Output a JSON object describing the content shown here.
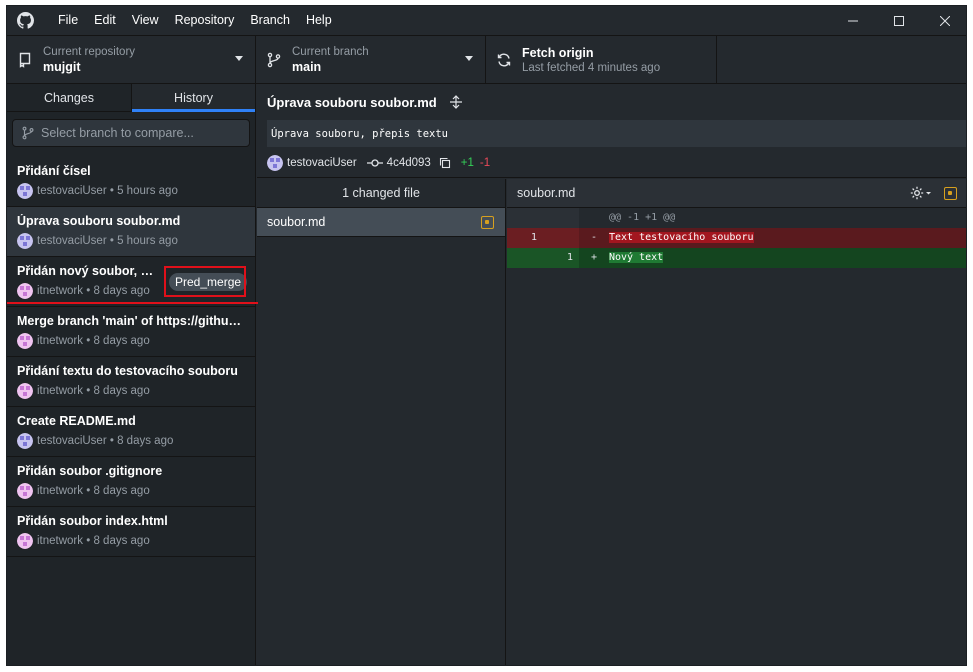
{
  "menu": [
    "File",
    "Edit",
    "View",
    "Repository",
    "Branch",
    "Help"
  ],
  "toolbar": {
    "repo": {
      "label": "Current repository",
      "value": "mujgit"
    },
    "branch": {
      "label": "Current branch",
      "value": "main"
    },
    "fetch": {
      "label": "Fetch origin",
      "value": "Last fetched 4 minutes ago"
    }
  },
  "sidebar": {
    "tabs": {
      "changes": "Changes",
      "history": "History"
    },
    "active_tab": "History",
    "compare_placeholder": "Select branch to compare...",
    "commits": [
      {
        "title": "Přidání čísel",
        "author": "testovaciUser",
        "time": "5 hours ago"
      },
      {
        "title": "Úprava souboru soubor.md",
        "author": "testovaciUser",
        "time": "5 hours ago",
        "selected": true
      },
      {
        "title": "Přidán nový soubor, sou...",
        "author": "itnetwork",
        "time": "8 days ago",
        "tag": "Pred_merge"
      },
      {
        "title": "Merge branch 'main' of https://github....",
        "author": "itnetwork",
        "time": "8 days ago"
      },
      {
        "title": "Přidání textu do testovacího souboru",
        "author": "itnetwork",
        "time": "8 days ago"
      },
      {
        "title": "Create README.md",
        "author": "testovaciUser",
        "time": "8 days ago"
      },
      {
        "title": "Přidán soubor .gitignore",
        "author": "itnetwork",
        "time": "8 days ago"
      },
      {
        "title": "Přidán soubor index.html",
        "author": "itnetwork",
        "time": "8 days ago"
      }
    ]
  },
  "commit_detail": {
    "title": "Úprava souboru soubor.md",
    "description": "Úprava souboru, přepis textu",
    "author": "testovaciUser",
    "sha": "4c4d093",
    "additions": "+1",
    "deletions": "-1"
  },
  "files": {
    "header": "1 changed file",
    "items": [
      {
        "name": "soubor.md",
        "status": "modified"
      }
    ]
  },
  "diff": {
    "file": "soubor.md",
    "hunk": "@@ -1 +1 @@",
    "lines": [
      {
        "type": "del",
        "old": "1",
        "new": "",
        "marker": "-",
        "text": "Text testovacího souboru"
      },
      {
        "type": "add",
        "old": "",
        "new": "1",
        "marker": "+",
        "text": "Nový text"
      }
    ]
  },
  "colors": {
    "accent": "#2f81f7",
    "highlight": "#e0101a",
    "modified": "#d7a01f",
    "added": "#34d058",
    "deleted": "#ea4a5a"
  }
}
